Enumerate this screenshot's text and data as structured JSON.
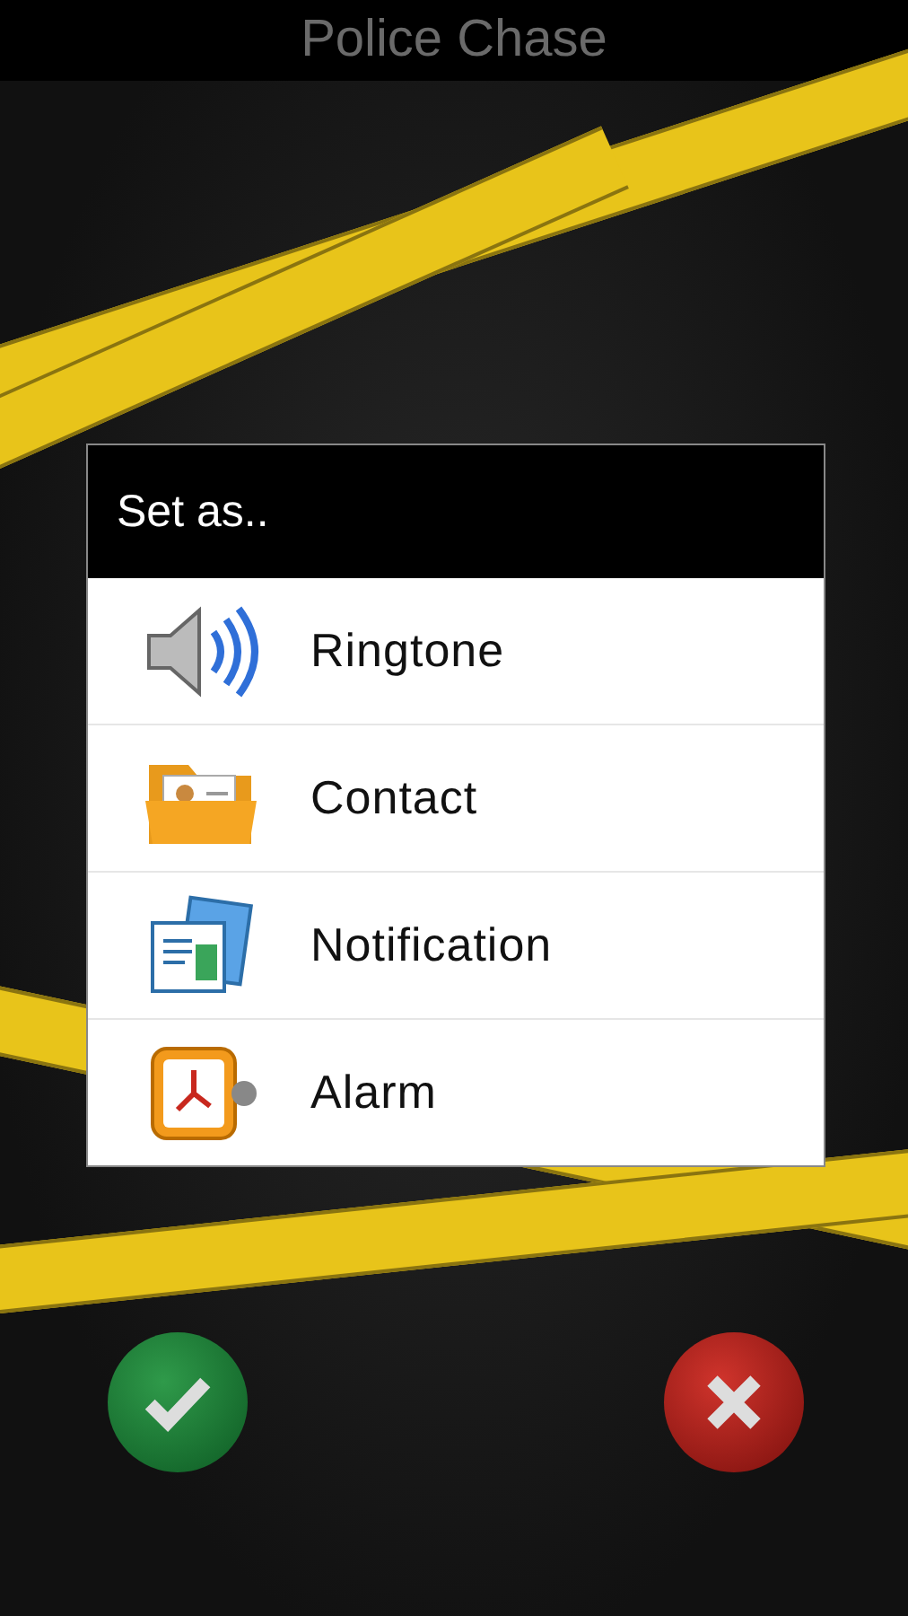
{
  "title": "Police Chase",
  "dialog": {
    "title": "Set as..",
    "items": [
      {
        "label": "Ringtone",
        "kind": "ringtone"
      },
      {
        "label": "Contact",
        "kind": "contact"
      },
      {
        "label": "Notification",
        "kind": "notification"
      },
      {
        "label": "Alarm",
        "kind": "alarm"
      }
    ]
  },
  "buttons": [
    {
      "kind": "confirm"
    },
    {
      "kind": "cancel"
    }
  ]
}
